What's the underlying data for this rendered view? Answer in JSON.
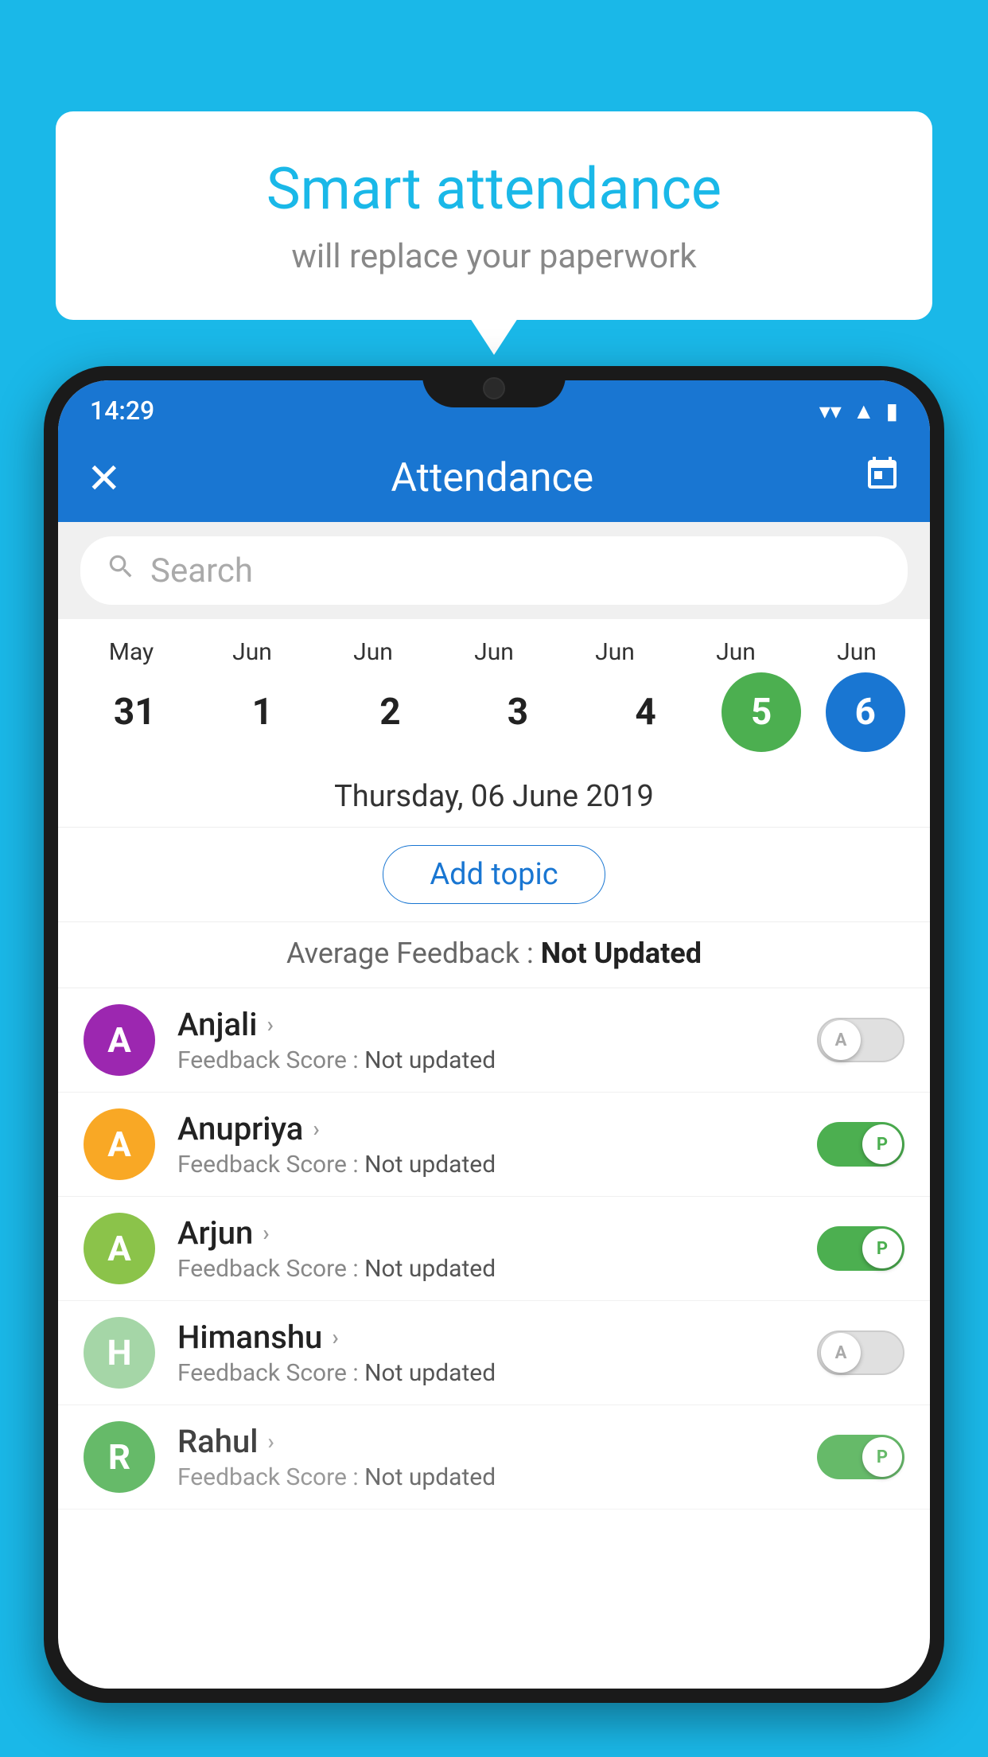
{
  "background_color": "#1ab8e8",
  "speech_bubble": {
    "title": "Smart attendance",
    "subtitle": "will replace your paperwork"
  },
  "status_bar": {
    "time": "14:29",
    "wifi": "▼",
    "signal": "▲",
    "battery": "▪"
  },
  "header": {
    "title": "Attendance",
    "close_label": "✕",
    "calendar_label": "📅"
  },
  "search": {
    "placeholder": "Search"
  },
  "calendar": {
    "months": [
      "May",
      "Jun",
      "Jun",
      "Jun",
      "Jun",
      "Jun",
      "Jun"
    ],
    "days": [
      "31",
      "1",
      "2",
      "3",
      "4",
      "5",
      "6"
    ],
    "today_index": 5,
    "selected_index": 6
  },
  "date_label": "Thursday, 06 June 2019",
  "add_topic_label": "Add topic",
  "avg_feedback": {
    "label": "Average Feedback : ",
    "value": "Not Updated"
  },
  "students": [
    {
      "name": "Anjali",
      "avatar_letter": "A",
      "avatar_color": "#9c27b0",
      "feedback_label": "Feedback Score : ",
      "feedback_value": "Not updated",
      "toggle": "off",
      "toggle_letter": "A"
    },
    {
      "name": "Anupriya",
      "avatar_letter": "A",
      "avatar_color": "#f9a825",
      "feedback_label": "Feedback Score : ",
      "feedback_value": "Not updated",
      "toggle": "on",
      "toggle_letter": "P"
    },
    {
      "name": "Arjun",
      "avatar_letter": "A",
      "avatar_color": "#8bc34a",
      "feedback_label": "Feedback Score : ",
      "feedback_value": "Not updated",
      "toggle": "on",
      "toggle_letter": "P"
    },
    {
      "name": "Himanshu",
      "avatar_letter": "H",
      "avatar_color": "#a5d6a7",
      "feedback_label": "Feedback Score : ",
      "feedback_value": "Not updated",
      "toggle": "off",
      "toggle_letter": "A"
    },
    {
      "name": "Rahul",
      "avatar_letter": "R",
      "avatar_color": "#4caf50",
      "feedback_label": "Feedback Score : ",
      "feedback_value": "Not updated",
      "toggle": "on",
      "toggle_letter": "P"
    }
  ]
}
